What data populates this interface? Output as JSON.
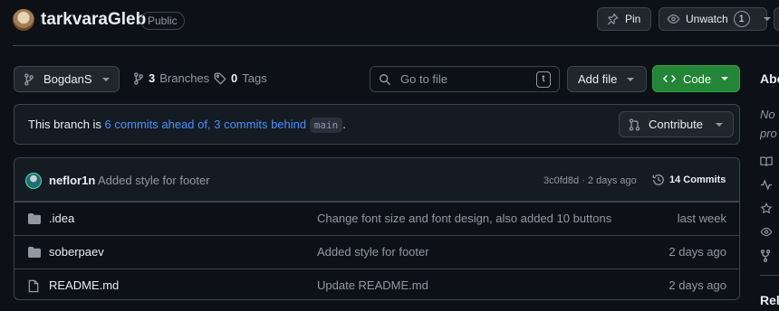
{
  "repo": {
    "name": "tarkvaraGleb",
    "visibility": "Public"
  },
  "header": {
    "pin_label": "Pin",
    "watch_label": "Unwatch",
    "watch_count": "1"
  },
  "toolbar": {
    "branch_name": "BogdanS",
    "branches_count": "3",
    "branches_label": "Branches",
    "tags_count": "0",
    "tags_label": "Tags",
    "goto_placeholder": "Go to file",
    "goto_shortcut": "t",
    "add_file_label": "Add file",
    "code_label": "Code"
  },
  "branch_info": {
    "prefix": "This branch is ",
    "ahead": "6 commits ahead of,",
    "behind": "3 commits behind",
    "base": "main",
    "suffix": ".",
    "contribute_label": "Contribute"
  },
  "latest_commit": {
    "author": "neflor1n",
    "message": "Added style for footer",
    "meta": "3c0fd8d · 2 days ago",
    "commits_label": "14 Commits"
  },
  "files": [
    {
      "name": ".idea",
      "type": "folder",
      "message": "Change font size and font design, also added 10 buttons",
      "time": "last week"
    },
    {
      "name": "soberpaev",
      "type": "folder",
      "message": "Added style for footer",
      "time": "2 days ago"
    },
    {
      "name": "README.md",
      "type": "file",
      "message": "Update README.md",
      "time": "2 days ago"
    }
  ],
  "sidebar": {
    "about_heading": "Abo",
    "description": "No pro",
    "icons": [
      "book-icon",
      "pulse-icon",
      "star-icon",
      "eye-icon",
      "fork-icon"
    ],
    "releases_heading": "Rele"
  },
  "colors": {
    "background": "#0d1117",
    "border": "#3d444d",
    "link": "#4493f8",
    "code_button": "#238636"
  }
}
